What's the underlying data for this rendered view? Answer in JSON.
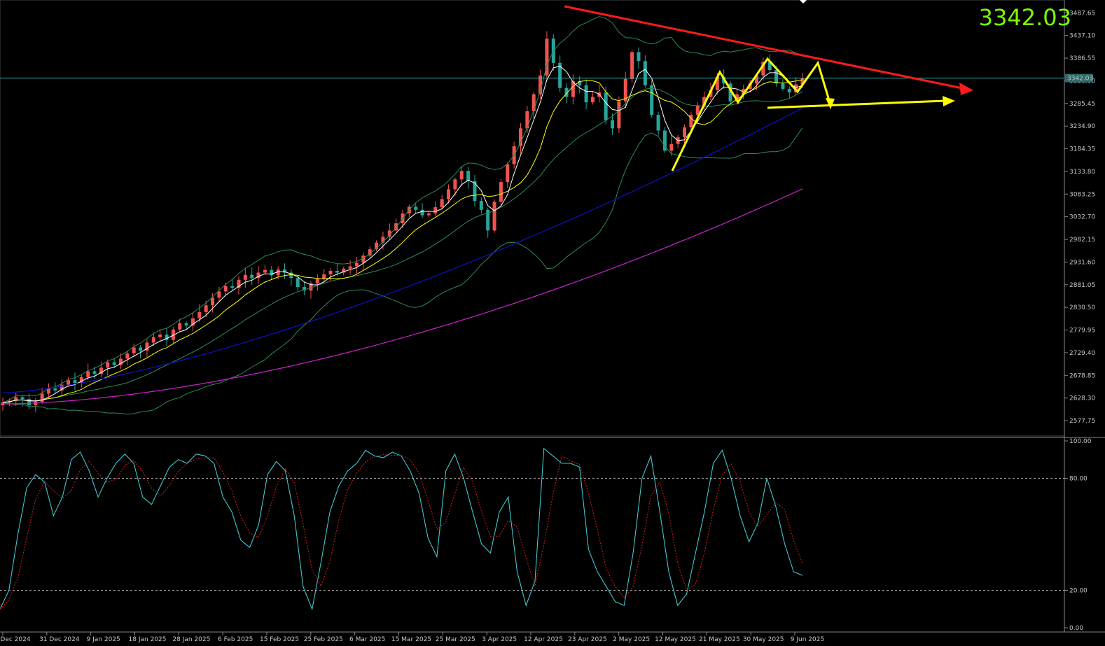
{
  "current_price": "3342.03",
  "current_price_tag": "3342.03",
  "colors": {
    "background": "#000000",
    "bull_candle": "#ef5350",
    "bear_candle": "#26a69a",
    "price_axis": "#c8c8c8",
    "price_line": "#2bb5b5",
    "bollinger": "#2e8b57",
    "ema_fast": "#ffffff",
    "ema_mid": "#ffff00",
    "ma_100": "#1010cc",
    "ma_200": "#cc22cc",
    "trendline_red": "#ff1a1a",
    "pattern_yellow": "#ffff00",
    "stoch_main": "#40c8d0",
    "stoch_signal": "#d02020"
  },
  "price_axis_ticks": [
    "3487.65",
    "3437.10",
    "3386.55",
    "3336.00",
    "3285.45",
    "3234.90",
    "3184.35",
    "3133.80",
    "3083.25",
    "3032.70",
    "2982.15",
    "2931.60",
    "2881.05",
    "2830.50",
    "2779.95",
    "2729.40",
    "2678.85",
    "2628.30",
    "2577.75"
  ],
  "stoch_axis_ticks": [
    "100.00",
    "80.00",
    "20.00",
    "0.00"
  ],
  "date_labels": [
    "Dec 2024",
    "31 Dec 2024",
    "9 Jan 2025",
    "18 Jan 2025",
    "28 Jan 2025",
    "6 Feb 2025",
    "15 Feb 2025",
    "25 Feb 2025",
    "6 Mar 2025",
    "15 Mar 2025",
    "25 Mar 2025",
    "3 Apr 2025",
    "12 Apr 2025",
    "23 Apr 2025",
    "2 May 2025",
    "12 May 2025",
    "21 May 2025",
    "30 May 2025",
    "9 Jun 2025"
  ],
  "chart_data": {
    "type": "candlestick",
    "title": "",
    "xlabel": "",
    "ylabel": "",
    "ylim": [
      2545,
      3510
    ],
    "stoch_ylim": [
      0,
      100
    ],
    "stoch_levels": [
      80,
      20
    ],
    "grid": false,
    "closes": [
      2618,
      2622,
      2630,
      2626,
      2612,
      2620,
      2638,
      2650,
      2645,
      2658,
      2668,
      2662,
      2675,
      2688,
      2682,
      2696,
      2708,
      2702,
      2716,
      2728,
      2741,
      2734,
      2752,
      2764,
      2770,
      2758,
      2781,
      2795,
      2790,
      2806,
      2820,
      2835,
      2852,
      2866,
      2878,
      2874,
      2892,
      2903,
      2896,
      2908,
      2914,
      2902,
      2915,
      2908,
      2896,
      2876,
      2868,
      2884,
      2894,
      2904,
      2912,
      2908,
      2917,
      2922,
      2930,
      2946,
      2960,
      2975,
      2988,
      3002,
      3018,
      3040,
      3055,
      3048,
      3036,
      3040,
      3054,
      3072,
      3094,
      3116,
      3135,
      3112,
      3068,
      3048,
      3002,
      3066,
      3110,
      3150,
      3190,
      3230,
      3268,
      3306,
      3348,
      3430,
      3376,
      3320,
      3300,
      3335,
      3326,
      3288,
      3300,
      3310,
      3248,
      3230,
      3290,
      3340,
      3400,
      3380,
      3326,
      3260,
      3225,
      3180,
      3195,
      3210,
      3232,
      3260,
      3280,
      3300,
      3315,
      3345,
      3330,
      3290,
      3306,
      3318,
      3330,
      3348,
      3378,
      3360,
      3330,
      3318,
      3310,
      3328,
      3342
    ],
    "stochastic": {
      "main": [
        10,
        20,
        50,
        75,
        82,
        78,
        60,
        70,
        90,
        94,
        84,
        70,
        80,
        88,
        93,
        88,
        70,
        66,
        76,
        86,
        90,
        88,
        93,
        92,
        88,
        70,
        62,
        47,
        43,
        55,
        82,
        89,
        84,
        60,
        22,
        10,
        35,
        62,
        76,
        84,
        88,
        95,
        92,
        91,
        94,
        92,
        84,
        72,
        48,
        38,
        84,
        93,
        80,
        62,
        45,
        40,
        62,
        70,
        30,
        12,
        25,
        96,
        92,
        88,
        88,
        86,
        42,
        30,
        22,
        14,
        12,
        40,
        80,
        92,
        62,
        30,
        12,
        18,
        40,
        62,
        88,
        95,
        80,
        60,
        46,
        56,
        80,
        65,
        45,
        30,
        28
      ]
    },
    "annotations": {
      "resistance_trendline": "descending red trendline from the April high",
      "support_arrow": "yellow horizontal arrow",
      "pattern": "yellow zigzag path"
    }
  }
}
